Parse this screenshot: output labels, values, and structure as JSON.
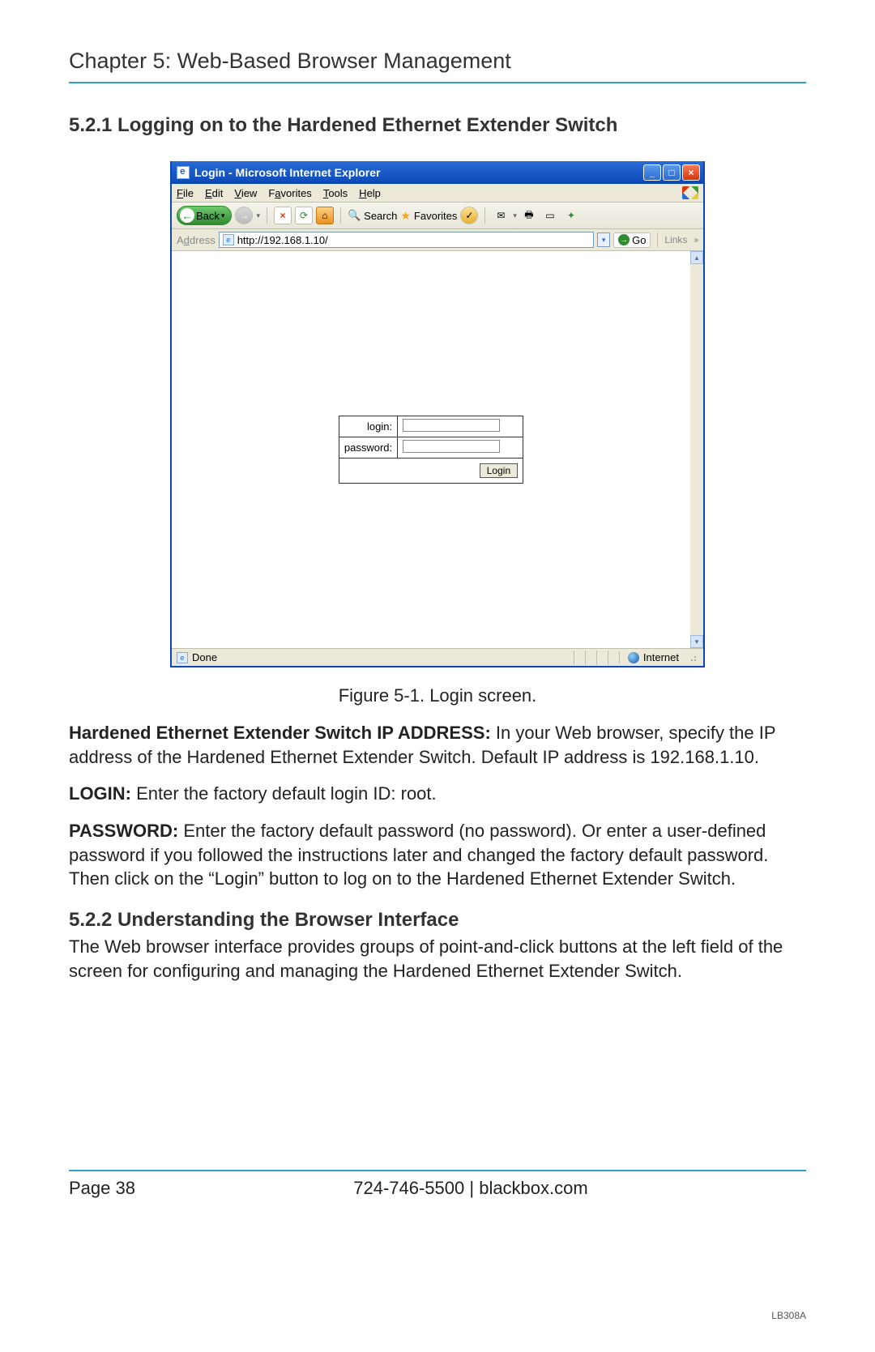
{
  "chapter_title": "Chapter 5: Web-Based Browser Management",
  "section_521": "5.2.1 Logging on to the Hardened Ethernet Extender Switch",
  "browser": {
    "title": "Login - Microsoft Internet Explorer",
    "menu": {
      "file": "File",
      "edit": "Edit",
      "view": "View",
      "favorites": "Favorites",
      "tools": "Tools",
      "help": "Help"
    },
    "toolbar": {
      "back": "Back",
      "search": "Search",
      "favorites": "Favorites"
    },
    "address_label": "Address",
    "address_url": "http://192.168.1.10/",
    "go": "Go",
    "links": "Links",
    "login_label": "login:",
    "password_label": "password:",
    "login_button": "Login",
    "status_done": "Done",
    "status_zone": "Internet"
  },
  "figure_caption": "Figure 5-1. Login screen.",
  "para_ip_bold": "Hardened Ethernet Extender Switch IP ADDRESS:",
  "para_ip_rest": " In your Web browser, specify the IP address of the Hardened Ethernet Extender Switch. Default IP address is 192.168.1.10.",
  "para_login_bold": "LOGIN:",
  "para_login_rest": " Enter the factory default login ID: root.",
  "para_pw_bold": "PASSWORD:",
  "para_pw_rest": " Enter the factory default password (no password). Or enter a user-defined password if you followed the instructions later and changed the factory default password. Then click on the “Login” button to log on to the Hardened Ethernet Extender Switch.",
  "section_522": "5.2.2 Understanding the Browser Interface",
  "para_522": "The Web browser interface provides groups of point-and-click buttons at the left field of the screen for configuring and managing the Hardened Ethernet Extender Switch.",
  "footer": {
    "page": "Page 38",
    "phone": "724-746-5500",
    "sep": "   |   ",
    "site": "blackbox.com",
    "model": "LB308A"
  }
}
